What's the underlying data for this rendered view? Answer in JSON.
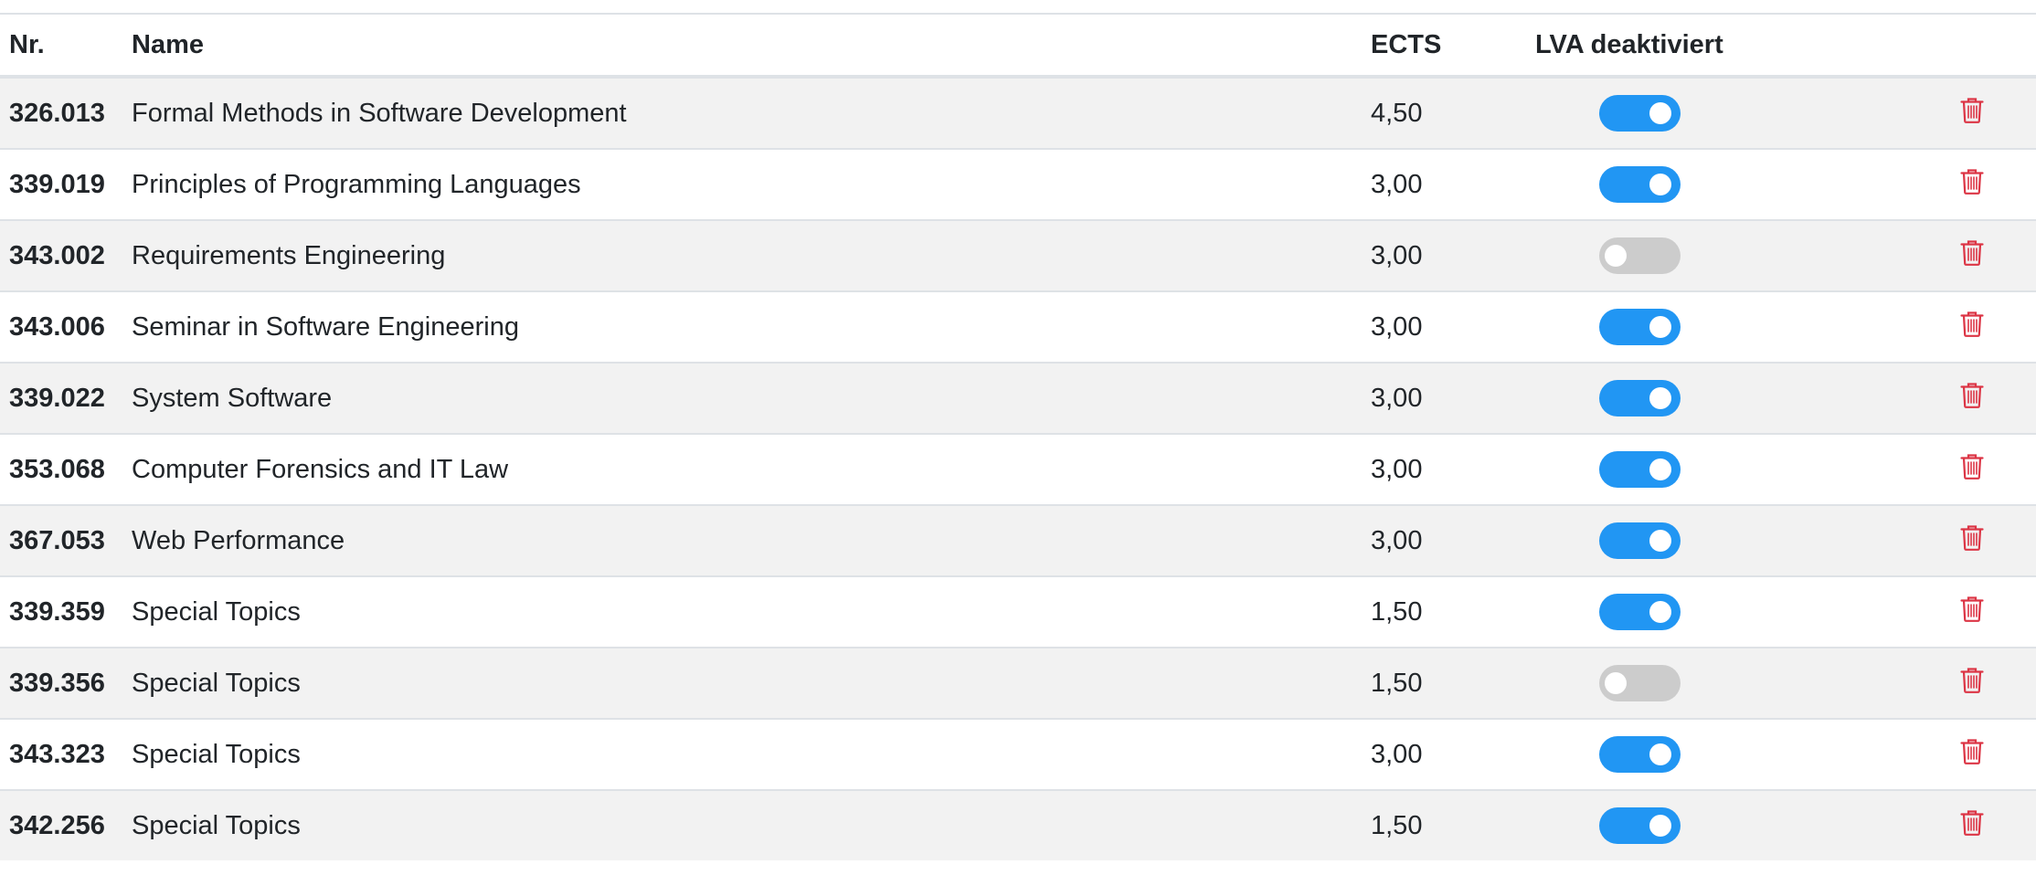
{
  "table": {
    "headers": {
      "nr": "Nr.",
      "name": "Name",
      "ects": "ECTS",
      "lva": "LVA deaktiviert"
    },
    "rows": [
      {
        "nr": "326.013",
        "name": "Formal Methods in Software Development",
        "ects": "4,50",
        "active": true
      },
      {
        "nr": "339.019",
        "name": "Principles of Programming Languages",
        "ects": "3,00",
        "active": true
      },
      {
        "nr": "343.002",
        "name": "Requirements Engineering",
        "ects": "3,00",
        "active": false
      },
      {
        "nr": "343.006",
        "name": "Seminar in Software Engineering",
        "ects": "3,00",
        "active": true
      },
      {
        "nr": "339.022",
        "name": "System Software",
        "ects": "3,00",
        "active": true
      },
      {
        "nr": "353.068",
        "name": "Computer Forensics and IT Law",
        "ects": "3,00",
        "active": true
      },
      {
        "nr": "367.053",
        "name": "Web Performance",
        "ects": "3,00",
        "active": true
      },
      {
        "nr": "339.359",
        "name": "Special Topics",
        "ects": "1,50",
        "active": true
      },
      {
        "nr": "339.356",
        "name": "Special Topics",
        "ects": "1,50",
        "active": false
      },
      {
        "nr": "343.323",
        "name": "Special Topics",
        "ects": "3,00",
        "active": true
      },
      {
        "nr": "342.256",
        "name": "Special Topics",
        "ects": "1,50",
        "active": true
      }
    ]
  },
  "colors": {
    "toggle_on": "#2196f3",
    "toggle_off": "#cccccc",
    "delete": "#dc3545",
    "stripe": "#f2f2f2"
  },
  "icons": {
    "delete": "trash-icon"
  }
}
